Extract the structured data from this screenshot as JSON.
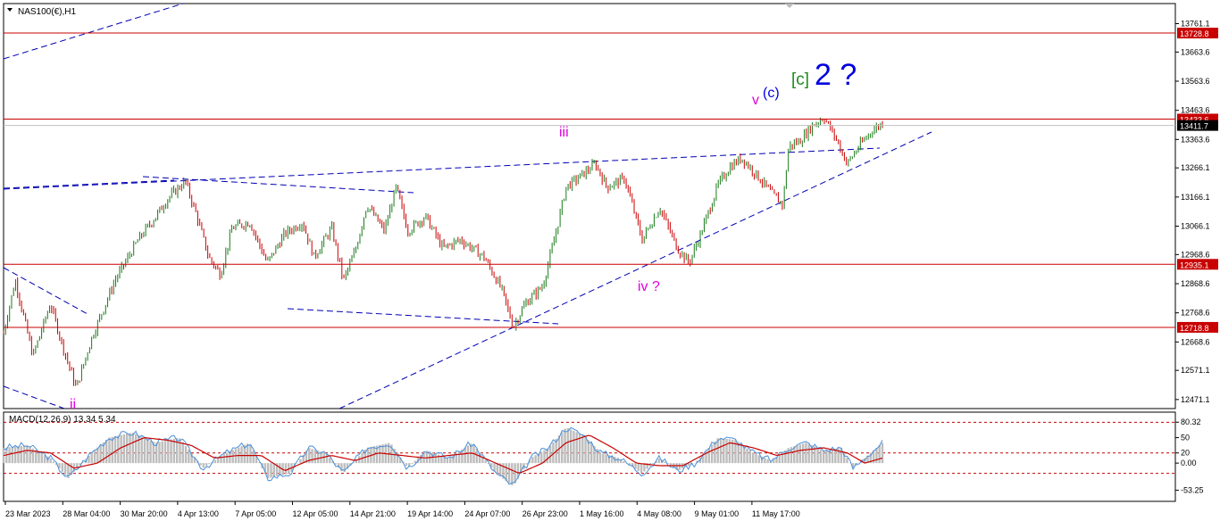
{
  "symbol_header": "NAS100(€),H1",
  "macd_header": "MACD(12,26,9) 13.34 5.34",
  "colors": {
    "bull": "#1a7a1a",
    "bear": "#c80000",
    "trend": "#0000b4",
    "level": "#c80000",
    "wave_pink": "#e000e0",
    "wave_blue": "#0000e0",
    "wave_green": "#1e8c1e",
    "macd_hist": "#bdbdbd",
    "macd_main": "#4a90d9",
    "macd_signal": "#c80000"
  },
  "chart_data": [
    {
      "type": "candlestick",
      "title": "NAS100(€),H1",
      "ylim": [
        12440,
        13830
      ],
      "y_ticks": [
        13761.1,
        13663.6,
        13563.6,
        13463.6,
        13363.6,
        13266.1,
        13166.1,
        13066.1,
        12968.6,
        12868.6,
        12768.6,
        12668.6,
        12571.1,
        12471.1
      ],
      "x_tick_labels": [
        "23 Mar 2023",
        "28 Mar 04:00",
        "30 Mar 20:00",
        "4 Apr 13:00",
        "7 Apr 05:00",
        "12 Apr 05:00",
        "14 Apr 21:00",
        "19 Apr 14:00",
        "24 Apr 07:00",
        "26 Apr 23:00",
        "1 May 16:00",
        "4 May 08:00",
        "9 May 01:00",
        "11 May 17:00"
      ],
      "price_path": [
        [
          0,
          12700
        ],
        [
          0.01,
          12880
        ],
        [
          0.025,
          12620
        ],
        [
          0.04,
          12800
        ],
        [
          0.05,
          12660
        ],
        [
          0.062,
          12510
        ],
        [
          0.075,
          12680
        ],
        [
          0.095,
          12880
        ],
        [
          0.115,
          13020
        ],
        [
          0.13,
          13100
        ],
        [
          0.14,
          13160
        ],
        [
          0.155,
          13220
        ],
        [
          0.165,
          13100
        ],
        [
          0.175,
          12960
        ],
        [
          0.185,
          12900
        ],
        [
          0.195,
          13060
        ],
        [
          0.21,
          13080
        ],
        [
          0.225,
          12940
        ],
        [
          0.24,
          13040
        ],
        [
          0.255,
          13080
        ],
        [
          0.265,
          12960
        ],
        [
          0.28,
          13060
        ],
        [
          0.29,
          12880
        ],
        [
          0.3,
          12980
        ],
        [
          0.31,
          13140
        ],
        [
          0.325,
          13050
        ],
        [
          0.335,
          13200
        ],
        [
          0.345,
          13050
        ],
        [
          0.36,
          13100
        ],
        [
          0.375,
          12990
        ],
        [
          0.39,
          13020
        ],
        [
          0.41,
          12960
        ],
        [
          0.425,
          12850
        ],
        [
          0.435,
          12720
        ],
        [
          0.445,
          12800
        ],
        [
          0.46,
          12860
        ],
        [
          0.47,
          13020
        ],
        [
          0.48,
          13200
        ],
        [
          0.49,
          13230
        ],
        [
          0.505,
          13280
        ],
        [
          0.515,
          13200
        ],
        [
          0.53,
          13230
        ],
        [
          0.545,
          13020
        ],
        [
          0.56,
          13130
        ],
        [
          0.575,
          12990
        ],
        [
          0.585,
          12940
        ],
        [
          0.595,
          13040
        ],
        [
          0.61,
          13210
        ],
        [
          0.62,
          13270
        ],
        [
          0.63,
          13300
        ],
        [
          0.645,
          13230
        ],
        [
          0.655,
          13180
        ],
        [
          0.665,
          13140
        ],
        [
          0.67,
          13340
        ],
        [
          0.68,
          13360
        ],
        [
          0.69,
          13410
        ],
        [
          0.7,
          13440
        ],
        [
          0.71,
          13370
        ],
        [
          0.72,
          13280
        ],
        [
          0.73,
          13340
        ],
        [
          0.74,
          13390
        ],
        [
          0.75,
          13420
        ]
      ],
      "horizontal_levels": [
        {
          "value": 13728.8,
          "label": "13728.8"
        },
        {
          "value": 13433.6,
          "label": "13433.6"
        },
        {
          "value": 12935.1,
          "label": "12935.1"
        },
        {
          "value": 12718.8,
          "label": "12718.8"
        }
      ],
      "current_price": {
        "value": 13411.7,
        "label": "13411.7"
      },
      "wave_labels": [
        {
          "text": "ii",
          "color": "wave_pink"
        },
        {
          "text": "iii",
          "color": "wave_pink"
        },
        {
          "text": "iv ?",
          "color": "wave_pink"
        },
        {
          "text": "v",
          "color": "wave_pink"
        },
        {
          "text": "(c)",
          "color": "wave_blue"
        },
        {
          "text": "[c]",
          "color": "wave_green"
        },
        {
          "text": "2 ?",
          "color": "wave_blue"
        }
      ]
    },
    {
      "type": "macd",
      "title": "MACD(12,26,9) 13.34 5.34",
      "ylim": [
        -75,
        100
      ],
      "y_ticks": [
        80.32,
        50,
        0.0,
        20,
        -53.25
      ],
      "y_tick_labels": [
        "80.32",
        "50",
        "0.00",
        "20",
        "-53.25"
      ],
      "levels": [
        80,
        20,
        -20
      ],
      "current": {
        "main": 13.34,
        "signal": 5.34
      },
      "main_path": [
        [
          0,
          30
        ],
        [
          0.02,
          35
        ],
        [
          0.04,
          10
        ],
        [
          0.055,
          -30
        ],
        [
          0.075,
          20
        ],
        [
          0.09,
          50
        ],
        [
          0.11,
          60
        ],
        [
          0.13,
          40
        ],
        [
          0.15,
          50
        ],
        [
          0.17,
          -10
        ],
        [
          0.19,
          20
        ],
        [
          0.21,
          40
        ],
        [
          0.225,
          -30
        ],
        [
          0.245,
          -20
        ],
        [
          0.26,
          30
        ],
        [
          0.275,
          20
        ],
        [
          0.29,
          -20
        ],
        [
          0.31,
          30
        ],
        [
          0.33,
          40
        ],
        [
          0.345,
          -10
        ],
        [
          0.36,
          25
        ],
        [
          0.38,
          10
        ],
        [
          0.4,
          40
        ],
        [
          0.42,
          -20
        ],
        [
          0.435,
          -45
        ],
        [
          0.45,
          10
        ],
        [
          0.465,
          30
        ],
        [
          0.48,
          70
        ],
        [
          0.495,
          55
        ],
        [
          0.51,
          20
        ],
        [
          0.525,
          10
        ],
        [
          0.545,
          -20
        ],
        [
          0.56,
          10
        ],
        [
          0.575,
          -15
        ],
        [
          0.59,
          0
        ],
        [
          0.61,
          50
        ],
        [
          0.625,
          45
        ],
        [
          0.64,
          20
        ],
        [
          0.655,
          5
        ],
        [
          0.67,
          30
        ],
        [
          0.685,
          40
        ],
        [
          0.7,
          25
        ],
        [
          0.715,
          30
        ],
        [
          0.725,
          -10
        ],
        [
          0.74,
          20
        ],
        [
          0.75,
          40
        ]
      ],
      "signal_path": [
        [
          0,
          15
        ],
        [
          0.02,
          25
        ],
        [
          0.04,
          20
        ],
        [
          0.06,
          -10
        ],
        [
          0.08,
          0
        ],
        [
          0.1,
          30
        ],
        [
          0.12,
          50
        ],
        [
          0.14,
          45
        ],
        [
          0.16,
          35
        ],
        [
          0.18,
          10
        ],
        [
          0.2,
          15
        ],
        [
          0.22,
          15
        ],
        [
          0.24,
          -15
        ],
        [
          0.26,
          5
        ],
        [
          0.28,
          15
        ],
        [
          0.3,
          5
        ],
        [
          0.32,
          20
        ],
        [
          0.34,
          15
        ],
        [
          0.36,
          10
        ],
        [
          0.38,
          15
        ],
        [
          0.4,
          20
        ],
        [
          0.42,
          0
        ],
        [
          0.44,
          -20
        ],
        [
          0.46,
          0
        ],
        [
          0.48,
          40
        ],
        [
          0.5,
          55
        ],
        [
          0.52,
          30
        ],
        [
          0.54,
          0
        ],
        [
          0.56,
          -5
        ],
        [
          0.58,
          -5
        ],
        [
          0.6,
          20
        ],
        [
          0.62,
          40
        ],
        [
          0.64,
          30
        ],
        [
          0.66,
          15
        ],
        [
          0.68,
          25
        ],
        [
          0.7,
          30
        ],
        [
          0.72,
          20
        ],
        [
          0.735,
          0
        ],
        [
          0.75,
          10
        ]
      ]
    }
  ]
}
